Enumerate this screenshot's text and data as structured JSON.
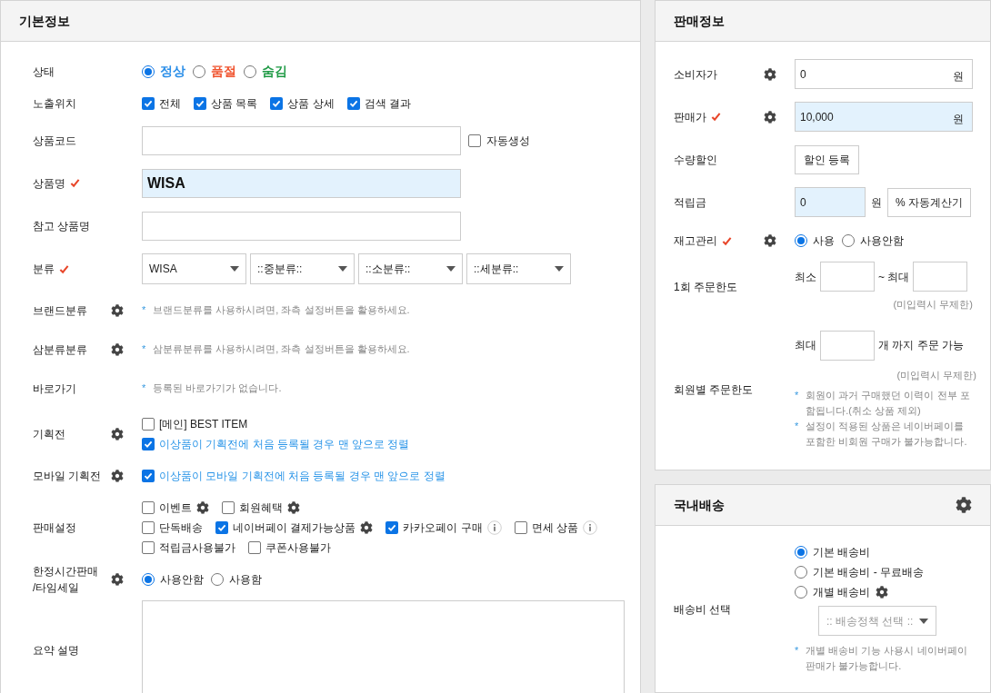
{
  "basic_info": {
    "title": "기본정보",
    "rows": [
      {
        "kind": "radio",
        "label": "상태",
        "options": [
          {
            "label": "정상",
            "selected": true,
            "color": "#2a8ee8"
          },
          {
            "label": "품절",
            "selected": false,
            "color": "#f0522d"
          },
          {
            "label": "숨김",
            "selected": false,
            "color": "#1f9a45"
          }
        ]
      },
      {
        "kind": "checks",
        "label": "노출위치",
        "lines": [
          [
            {
              "label": "전체",
              "checked": true
            },
            {
              "label": "상품 목록",
              "checked": true
            },
            {
              "label": "상품 상세",
              "checked": true
            },
            {
              "label": "검색 결과",
              "checked": true
            }
          ]
        ]
      },
      {
        "kind": "field",
        "label": "상품코드",
        "field": {
          "highlighted": false
        },
        "checkbox": {
          "label": "자동생성",
          "checked": false
        }
      },
      {
        "kind": "field",
        "label": "상품명",
        "required": true,
        "field": {
          "value": "WISA",
          "highlighted": true
        }
      },
      {
        "kind": "field",
        "label": "참고 상품명",
        "field": {
          "highlighted": false
        }
      },
      {
        "kind": "selects",
        "label": "분류",
        "required": true,
        "selects": [
          "WISA",
          "::중분류::",
          "::소분류::",
          "::세분류::"
        ]
      },
      {
        "kind": "note",
        "label": "브랜드분류",
        "gear": true,
        "note": {
          "mark": "*",
          "text": "브랜드분류를 사용하시려면, 좌측 설정버튼을 활용하세요."
        }
      },
      {
        "kind": "note",
        "label": "삼분류분류",
        "gear": true,
        "note": {
          "mark": "*",
          "text": "삼분류분류를 사용하시려면, 좌측 설정버튼을 활용하세요."
        }
      },
      {
        "kind": "note",
        "label": "바로가기",
        "note": {
          "mark": "*",
          "text": "등록된 바로가기가 없습니다."
        }
      },
      {
        "kind": "checks",
        "label": "기획전",
        "gear": true,
        "lines": [
          [
            {
              "label": "[메인] BEST ITEM",
              "checked": false,
              "accent": false
            }
          ],
          [
            {
              "label": "이상품이 기획전에 처음 등록될 경우 맨 앞으로 정렬",
              "checked": true,
              "accent": true
            }
          ]
        ]
      },
      {
        "kind": "checks",
        "label": "모바일 기획전",
        "gear": true,
        "lines": [
          [
            {
              "label": "이상품이 모바일 기획전에 처음 등록될 경우 맨 앞으로 정렬",
              "checked": true,
              "accent": true
            }
          ]
        ]
      },
      {
        "kind": "checks",
        "label": "판매설정",
        "lines": [
          [
            {
              "kind": "gear",
              "label": "이벤트",
              "checked": false
            },
            {
              "kind": "gear",
              "label": "회원혜택",
              "checked": false
            }
          ],
          [
            {
              "kind": "plain",
              "label": "단독배송",
              "checked": false
            },
            {
              "kind": "gear",
              "label": "네이버페이 결제가능상품",
              "checked": true
            },
            {
              "kind": "info",
              "label": "카카오페이 구매",
              "checked": true
            },
            {
              "kind": "info",
              "label": "면세 상품",
              "checked": false
            }
          ],
          [
            {
              "kind": "plain",
              "label": "적립금사용불가",
              "checked": false
            },
            {
              "kind": "plain",
              "label": "쿠폰사용불가",
              "checked": false
            }
          ]
        ]
      },
      {
        "kind": "radio",
        "label": "한정시간판매\n/타임세일",
        "gear": true,
        "options": [
          {
            "label": "사용안함",
            "selected": true
          },
          {
            "label": "사용함",
            "selected": false
          }
        ]
      },
      {
        "kind": "textarea",
        "label": "요약 설명"
      }
    ]
  },
  "sales_info": {
    "title": "판매정보",
    "rows": [
      {
        "kind": "amount",
        "label": "소비자가",
        "gear": true,
        "value": "0",
        "unit": "원",
        "highlighted": false
      },
      {
        "kind": "amount",
        "label": "판매가",
        "required": true,
        "gear": true,
        "value": "10,000",
        "unit": "원",
        "highlighted": true
      },
      {
        "kind": "button",
        "label": "수량할인",
        "button": "할인 등록"
      },
      {
        "kind": "points",
        "label": "적립금",
        "value": "0",
        "unit": "원",
        "highlighted": true,
        "button": "% 자동계산기"
      },
      {
        "kind": "radio",
        "label": "재고관리",
        "required": true,
        "gear": true,
        "options": [
          {
            "label": "사용",
            "selected": true
          },
          {
            "label": "사용안함",
            "selected": false
          }
        ]
      },
      {
        "kind": "range",
        "label": "1회 주문한도",
        "min_label": "최소",
        "max_label": "~ 최대",
        "hint": "(미입력시 무제한)"
      },
      {
        "kind": "member_limit",
        "label": "회원별 주문한도",
        "prefix": "최대",
        "suffix": "개 까지 주문 가능",
        "hint": "(미입력시 무제한)",
        "notes": [
          {
            "mark": "*",
            "text": "회원이 과거 구매했던 이력이 전부 포함됩니다.(취소 상품 제외)"
          },
          {
            "mark": "*",
            "text": "설정이 적용된 상품은 네이버페이를 포함한 비회원 구매가 불가능합니다."
          }
        ]
      }
    ]
  },
  "domestic_shipping": {
    "title": "국내배송",
    "gear": true,
    "rows": [
      {
        "kind": "shipping",
        "label": "배송비 선택",
        "options": [
          {
            "kind": "plain",
            "label": "기본 배송비",
            "selected": true
          },
          {
            "kind": "plain",
            "label": "기본 배송비 - 무료배송",
            "selected": false
          },
          {
            "kind": "gear",
            "label": "개별 배송비",
            "selected": false
          }
        ],
        "select": {
          "placeholder": ":: 배송정책 선택 ::",
          "disabled": true
        },
        "notes": [
          {
            "mark": "*",
            "text": "개별 배송비 기능 사용시 네이버페이 판매가 불가능합니다."
          }
        ]
      }
    ]
  }
}
